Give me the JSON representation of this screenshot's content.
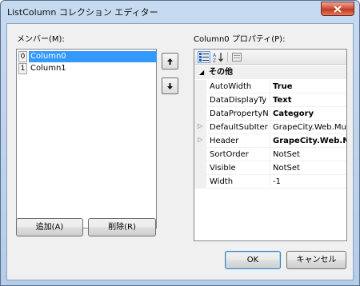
{
  "window": {
    "title": "ListColumn コレクション エディター"
  },
  "members": {
    "label": "メンバー(M):",
    "items": [
      {
        "index": "0",
        "name": "Column0",
        "selected": true
      },
      {
        "index": "1",
        "name": "Column1",
        "selected": false
      }
    ]
  },
  "buttons": {
    "add": "追加(A)",
    "remove": "削除(R)",
    "ok": "OK",
    "cancel": "キャンセル"
  },
  "properties": {
    "label": "Column0 プロパティ(P):",
    "category": "その他",
    "rows": [
      {
        "name": "AutoWidth",
        "value": "True",
        "bold": true,
        "expandable": false
      },
      {
        "name": "DataDisplayTy",
        "value": "Text",
        "bold": true,
        "expandable": false
      },
      {
        "name": "DataPropertyN",
        "value": "Category",
        "bold": true,
        "expandable": false
      },
      {
        "name": "DefaultSubIter",
        "value": "GrapeCity.Web.MultiR",
        "bold": false,
        "expandable": true
      },
      {
        "name": "Header",
        "value": "GrapeCity.Web.Multi",
        "bold": true,
        "expandable": true
      },
      {
        "name": "SortOrder",
        "value": "NotSet",
        "bold": false,
        "expandable": false
      },
      {
        "name": "Visible",
        "value": "NotSet",
        "bold": false,
        "expandable": false
      },
      {
        "name": "Width",
        "value": "-1",
        "bold": false,
        "expandable": false
      }
    ]
  },
  "icons": {
    "close": "close-icon",
    "up": "arrow-up-icon",
    "down": "arrow-down-icon",
    "categorized": "categorized-icon",
    "alphabetical": "sort-alphabetical-icon",
    "pages": "property-pages-icon"
  },
  "colors": {
    "selection": "#3399ff",
    "close": "#c2381f"
  }
}
